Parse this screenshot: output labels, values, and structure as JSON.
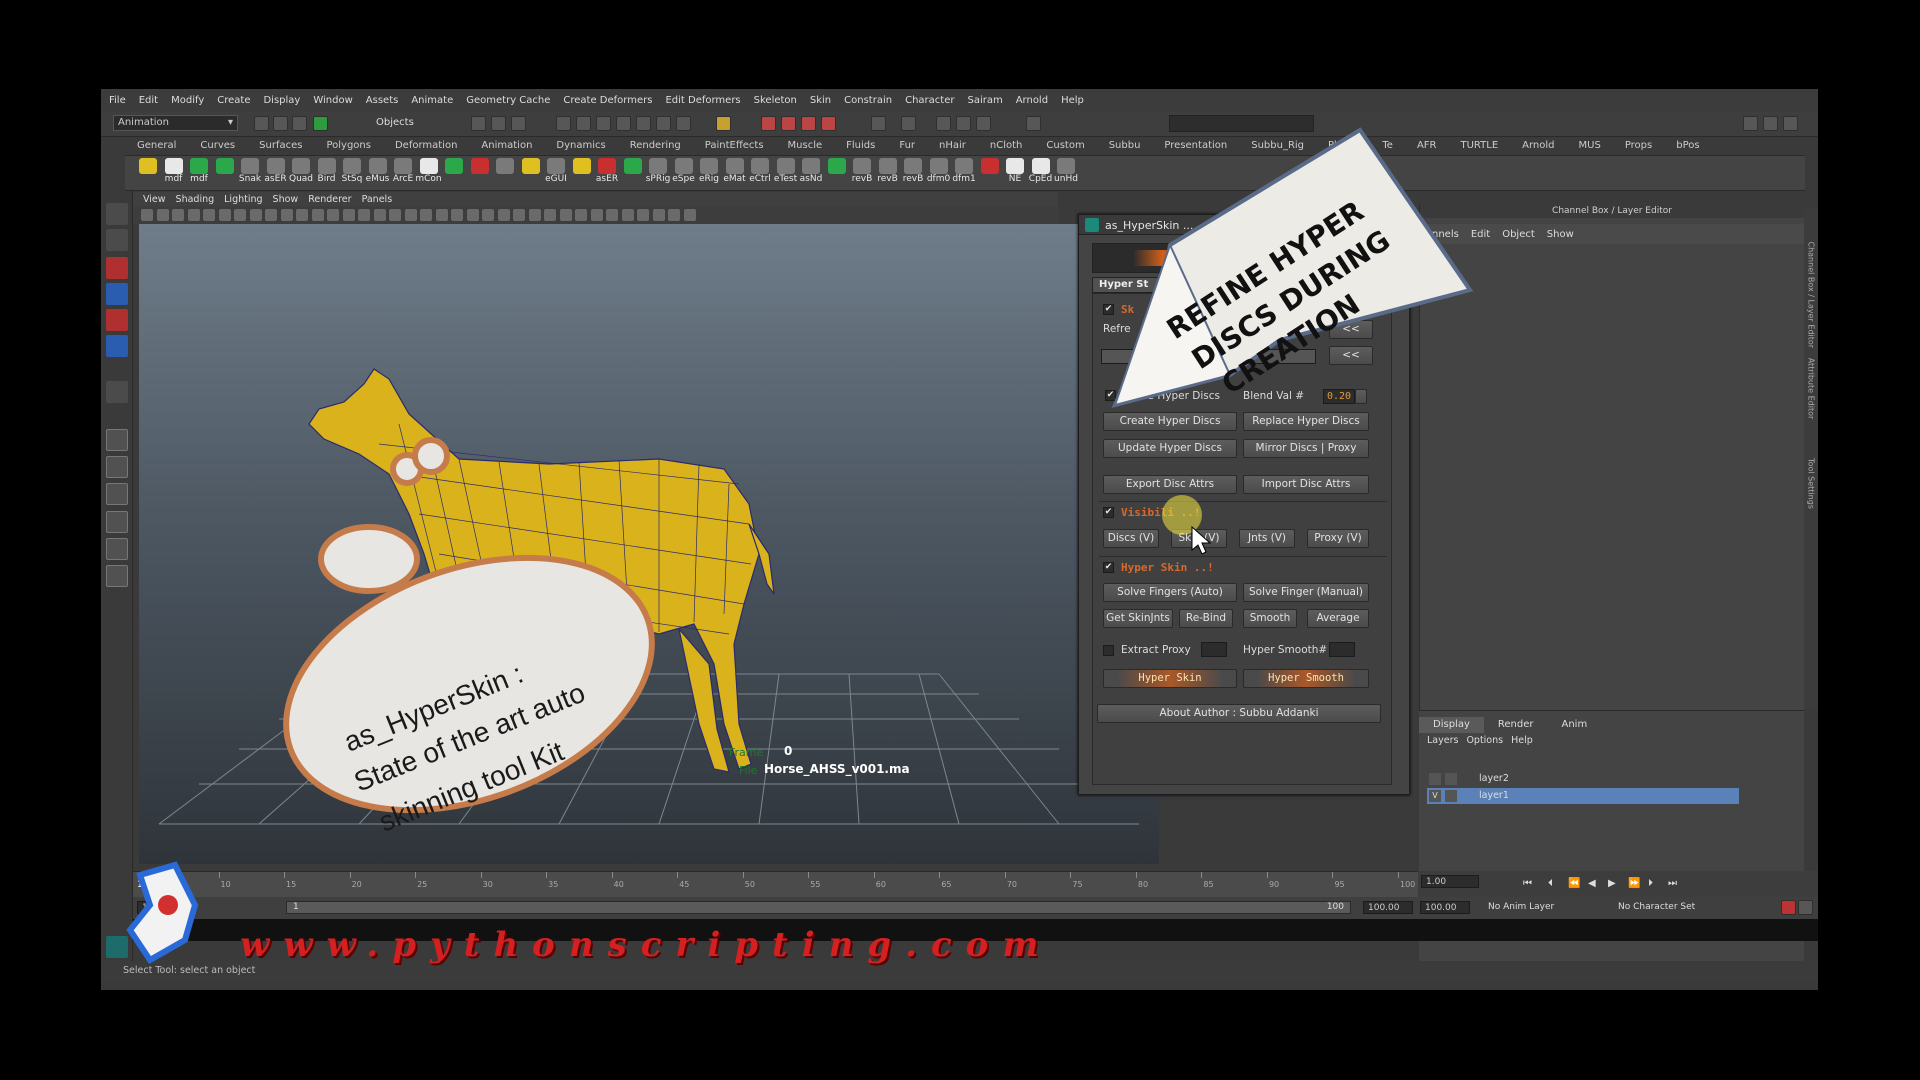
{
  "menubar": [
    "File",
    "Edit",
    "Modify",
    "Create",
    "Display",
    "Window",
    "Assets",
    "Animate",
    "Geometry Cache",
    "Create Deformers",
    "Edit Deformers",
    "Skeleton",
    "Skin",
    "Constrain",
    "Character",
    "Sairam",
    "Arnold",
    "Help"
  ],
  "statusline": {
    "mode": "Animation",
    "objects_label": "Objects"
  },
  "shelf_tabs": [
    "General",
    "Curves",
    "Surfaces",
    "Polygons",
    "Deformation",
    "Animation",
    "Dynamics",
    "Rendering",
    "PaintEffects",
    "Muscle",
    "Fluids",
    "Fur",
    "nHair",
    "nCloth",
    "Custom",
    "Subbu",
    "Presentation",
    "Subbu_Rig",
    "PhysX",
    "Te",
    "AFR",
    "TURTLE",
    "Arnold",
    "MUS",
    "Props",
    "bPos"
  ],
  "shelf_buttons": [
    "",
    "mdf",
    "mdf",
    "",
    "Snak",
    "asER",
    "Quad",
    "Bird",
    "StSq",
    "eMus",
    "ArcE",
    "mCon",
    "",
    "",
    "",
    "",
    "eGUI",
    "",
    "asER",
    "",
    "sPRig",
    "eSpe",
    "eRig",
    "eMat",
    "eCtrl",
    "eTest",
    "asNd",
    "",
    "revB",
    "revB",
    "revB",
    "dfm0",
    "dfm1",
    "",
    "NE",
    "CpEd",
    "unHd"
  ],
  "viewport_menu": [
    "View",
    "Shading",
    "Lighting",
    "Show",
    "Renderer",
    "Panels"
  ],
  "hud": {
    "frame_label": "Frame",
    "frame_value": "0",
    "file_label": "File",
    "file_value": "Horse_AHSS_v001.ma"
  },
  "callout_cloud": {
    "line1": "as_HyperSkin :",
    "line2": "State of the art auto",
    "line3": "skinning tool Kit"
  },
  "callout_arrow": {
    "line1": "REFINE HYPER",
    "line2": "DISCS DURING",
    "line3": "CREATION"
  },
  "hyperskin": {
    "title": "as_HyperSkin ...",
    "tab": "Hyper St",
    "section1_title": "Sk",
    "refine_label": "Refre",
    "row_btn_1": "<<",
    "row_btn_2": "<<",
    "refine_checkbox": "Refine Hyper Discs",
    "blend_label": "Blend Val #",
    "blend_value": "0.20",
    "btn_create": "Create Hyper Discs",
    "btn_replace": "Replace Hyper Discs",
    "btn_update": "Update Hyper Discs",
    "btn_mirror": "Mirror Discs | Proxy",
    "btn_export": "Export Disc Attrs",
    "btn_import": "Import Disc Attrs",
    "visibility_title": "Visibili   ..!",
    "btn_discs_v": "Discs (V)",
    "btn_skin_v": "Skin (V)",
    "btn_jnts_v": "Jnts (V)",
    "btn_proxy_v": "Proxy (V)",
    "hyperskin_title": "Hyper Skin ..!",
    "btn_solve_auto": "Solve Fingers (Auto)",
    "btn_solve_manual": "Solve Finger (Manual)",
    "btn_get_skin": "Get SkinJnts",
    "btn_rebind": "Re-Bind",
    "btn_smooth": "Smooth",
    "btn_average": "Average",
    "extract_proxy": "Extract Proxy",
    "hyper_smooth_label": "Hyper Smooth#",
    "btn_hyper_skin": "Hyper Skin",
    "btn_hyper_smooth": "Hyper Smooth",
    "btn_about": "About Author : Subbu Addanki"
  },
  "channelbox": {
    "title": "Channel Box / Layer Editor",
    "menu": [
      "nnels",
      "Edit",
      "Object",
      "Show"
    ]
  },
  "side_tabs": [
    "Channel Box / Layer Editor",
    "Attribute Editor",
    "Tool Settings"
  ],
  "layer_editor": {
    "tabs": [
      "Display",
      "Render",
      "Anim"
    ],
    "menu": [
      "Layers",
      "Options",
      "Help"
    ],
    "layers": [
      {
        "v": "",
        "name": "layer2",
        "selected": false
      },
      {
        "v": "V",
        "name": "layer1",
        "selected": true
      }
    ]
  },
  "timeline": {
    "start": "1",
    "ticks": [
      "1",
      "10",
      "15",
      "20",
      "25",
      "30",
      "35",
      "40",
      "45",
      "50",
      "55",
      "60",
      "65",
      "70",
      "75",
      "80",
      "85",
      "90",
      "95",
      "100"
    ],
    "current_frame": "1.00",
    "range_start": "1.00",
    "range_start_inner": "1",
    "range_end_inner": "100",
    "end_time": "100.00",
    "end_time2": "100.00",
    "anim_layer": "No Anim Layer",
    "char_set": "No Character Set"
  },
  "helpline": "Select Tool: select an object",
  "watermark": "www.pythonscripting.com"
}
